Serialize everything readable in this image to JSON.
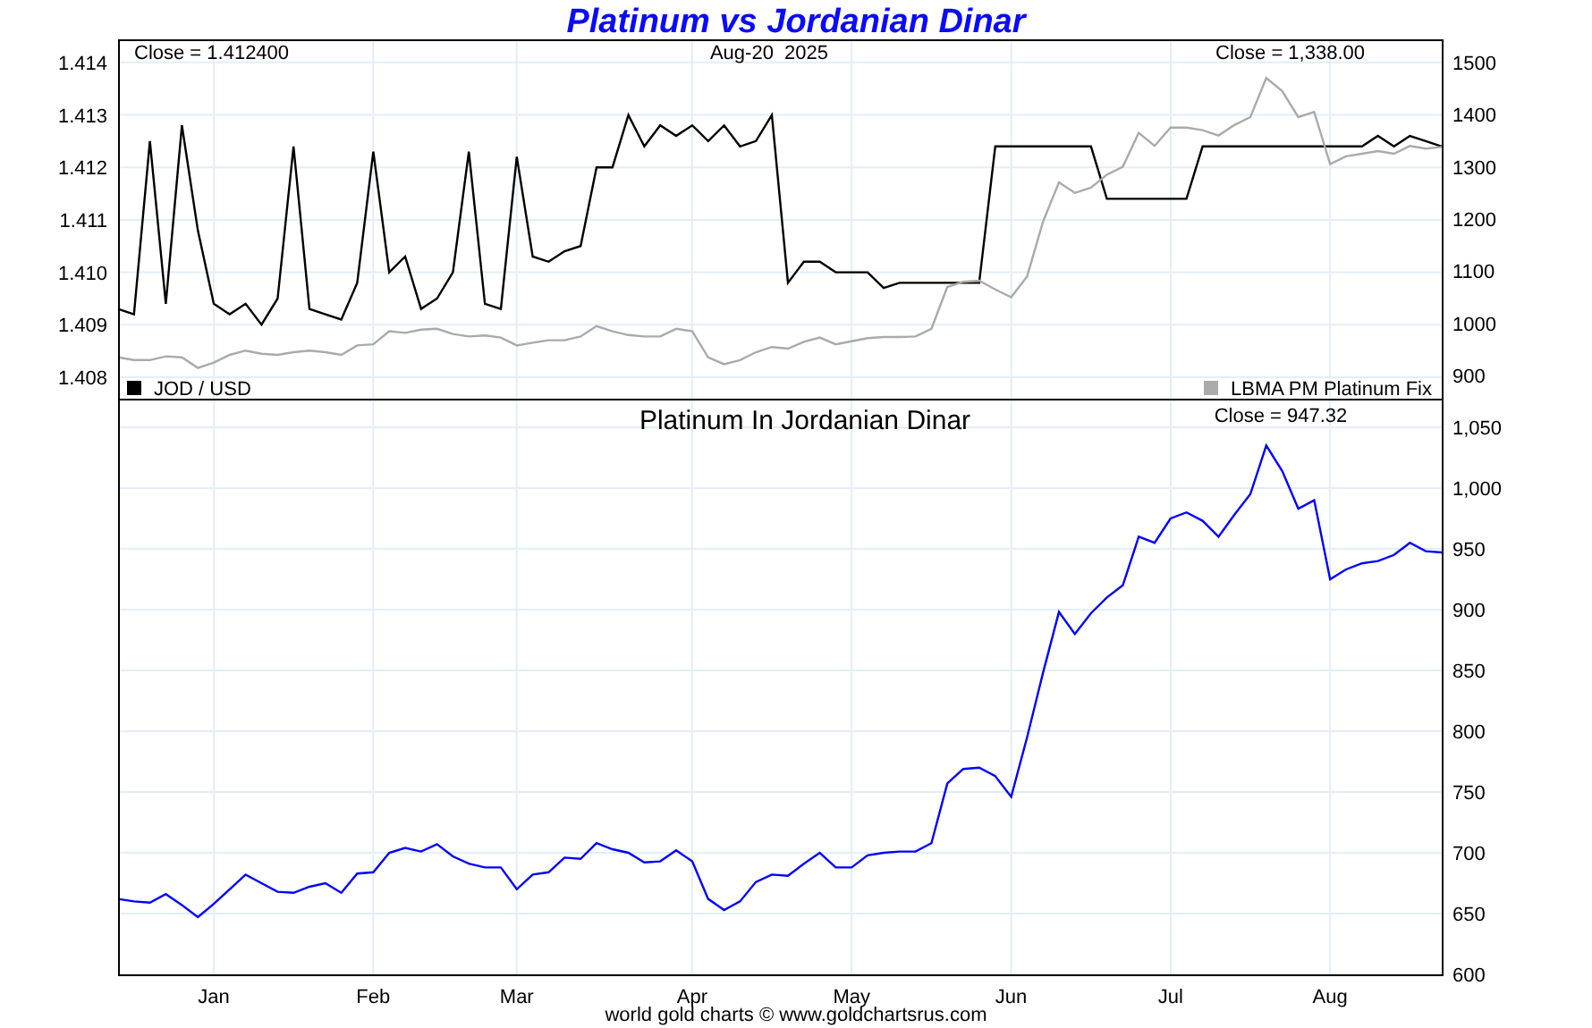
{
  "title": "Platinum vs Jordanian Dinar",
  "upper_panel": {
    "date": "Aug-20  2025",
    "jod_chart": {
      "chart_data": {
        "type": "line",
        "grid": true,
        "ylim": [
          1.40759,
          1.41444
        ],
        "yticks": [
          {
            "value": 1.408,
            "label": "1.408"
          },
          {
            "value": 1.409,
            "label": "1.409"
          },
          {
            "value": 1.41,
            "label": "1.410"
          },
          {
            "value": 1.411,
            "label": "1.411"
          },
          {
            "value": 1.412,
            "label": "1.412"
          },
          {
            "value": 1.413,
            "label": "1.413"
          },
          {
            "value": 1.414,
            "label": "1.414"
          }
        ],
        "annotations": [
          {
            "text": "Close = 1.412400"
          }
        ],
        "series": [
          {
            "name": "JOD / USD",
            "color": "#000000",
            "values": [
              1.4093,
              1.4092,
              1.4125,
              1.4094,
              1.4128,
              1.4108,
              1.4094,
              1.4092,
              1.4094,
              1.409,
              1.4095,
              1.4124,
              1.4093,
              1.4092,
              1.4091,
              1.4098,
              1.4123,
              1.41,
              1.4103,
              1.4093,
              1.4095,
              1.41,
              1.4123,
              1.4094,
              1.4093,
              1.4122,
              1.4103,
              1.4102,
              1.4104,
              1.4105,
              1.412,
              1.412,
              1.413,
              1.4124,
              1.4128,
              1.4126,
              1.4128,
              1.4125,
              1.4128,
              1.4124,
              1.4125,
              1.413,
              1.4098,
              1.4102,
              1.4102,
              1.41,
              1.41,
              1.41,
              1.4097,
              1.4098,
              1.4098,
              1.4098,
              1.4098,
              1.4098,
              1.4098,
              1.4124,
              1.4124,
              1.4124,
              1.4124,
              1.4124,
              1.4124,
              1.4124,
              1.4114,
              1.4114,
              1.4114,
              1.4114,
              1.4114,
              1.4114,
              1.4124,
              1.4124,
              1.4124,
              1.4124,
              1.4124,
              1.4124,
              1.4124,
              1.4124,
              1.4124,
              1.4124,
              1.4124,
              1.4126,
              1.4124,
              1.4126,
              1.4125,
              1.4124
            ]
          }
        ]
      }
    },
    "platinum_usd_chart": {
      "chart_data": {
        "type": "line",
        "ylim": [
          856,
          1544
        ],
        "yticks": [
          {
            "value": 900,
            "label": "900"
          },
          {
            "value": 1000,
            "label": "1000"
          },
          {
            "value": 1100,
            "label": "1100"
          },
          {
            "value": 1200,
            "label": "1200"
          },
          {
            "value": 1300,
            "label": "1300"
          },
          {
            "value": 1400,
            "label": "1400"
          },
          {
            "value": 1500,
            "label": "1500"
          }
        ],
        "annotations": [
          {
            "text": "Close = 1,338.00"
          }
        ],
        "series": [
          {
            "name": "LBMA PM Platinum Fix",
            "color": "#aaaaaa",
            "values": [
              935,
              930,
              930,
              937,
              935,
              915,
              925,
              940,
              948,
              942,
              940,
              945,
              948,
              945,
              940,
              958,
              960,
              985,
              982,
              988,
              990,
              980,
              975,
              977,
              973,
              958,
              963,
              968,
              968,
              975,
              995,
              985,
              978,
              975,
              975,
              990,
              985,
              935,
              922,
              930,
              945,
              955,
              952,
              965,
              973,
              960,
              966,
              972,
              974,
              974,
              975,
              990,
              1070,
              1080,
              1082,
              1065,
              1050,
              1090,
              1195,
              1270,
              1250,
              1260,
              1285,
              1300,
              1365,
              1340,
              1375,
              1375,
              1370,
              1360,
              1380,
              1395,
              1470,
              1445,
              1395,
              1405,
              1305,
              1320,
              1325,
              1330,
              1325,
              1340,
              1335,
              1338
            ]
          }
        ]
      }
    }
  },
  "lower_panel": {
    "chart_data": {
      "type": "line",
      "grid": true,
      "title": "Platinum In Jordanian Dinar",
      "ylim": [
        600,
        1072
      ],
      "categories": [
        null,
        null,
        null,
        null,
        null,
        null,
        "Jan",
        null,
        null,
        null,
        null,
        null,
        null,
        null,
        null,
        null,
        "Feb",
        null,
        null,
        null,
        null,
        null,
        null,
        null,
        null,
        "Mar",
        null,
        null,
        null,
        null,
        null,
        null,
        null,
        null,
        null,
        null,
        "Apr",
        null,
        null,
        null,
        null,
        null,
        null,
        null,
        null,
        null,
        "May",
        null,
        null,
        null,
        null,
        null,
        null,
        null,
        null,
        null,
        "Jun",
        null,
        null,
        null,
        null,
        null,
        null,
        null,
        null,
        null,
        "Jul",
        null,
        null,
        null,
        null,
        null,
        null,
        null,
        null,
        null,
        "Aug",
        null,
        null,
        null,
        null,
        null,
        null,
        null
      ],
      "yticks": [
        {
          "value": 600,
          "label": "600"
        },
        {
          "value": 650,
          "label": "650"
        },
        {
          "value": 700,
          "label": "700"
        },
        {
          "value": 750,
          "label": "750"
        },
        {
          "value": 800,
          "label": "800"
        },
        {
          "value": 850,
          "label": "850"
        },
        {
          "value": 900,
          "label": "900"
        },
        {
          "value": 950,
          "label": "950"
        },
        {
          "value": 1000,
          "label": "1,000"
        },
        {
          "value": 1050,
          "label": "1,050"
        }
      ],
      "annotations": [
        {
          "text": "Close = 947.32"
        }
      ],
      "series": [
        {
          "color": "#0000ff",
          "values": [
            662,
            660,
            659,
            666,
            657,
            647,
            658,
            670,
            682,
            675,
            668,
            667,
            672,
            675,
            667,
            683,
            684,
            700,
            704,
            701,
            707,
            697,
            691,
            688,
            688,
            670,
            682,
            684,
            696,
            695,
            708,
            703,
            700,
            692,
            693,
            702,
            693,
            662,
            653,
            660,
            676,
            682,
            681,
            691,
            700,
            688,
            688,
            698,
            700,
            701,
            701,
            708,
            757,
            769,
            770,
            763,
            746,
            795,
            848,
            898,
            880,
            897,
            910,
            920,
            960,
            955,
            975,
            980,
            973,
            960,
            978,
            995,
            1035,
            1014,
            983,
            990,
            925,
            933,
            938,
            940,
            945,
            955,
            948,
            947
          ]
        }
      ]
    }
  },
  "footer": "world gold charts © www.goldchartsrus.com"
}
